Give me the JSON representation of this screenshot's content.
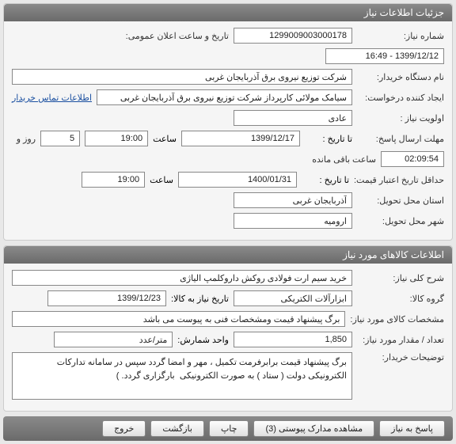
{
  "panel1": {
    "title": "جزئیات اطلاعات نیاز",
    "need_number_label": "شماره نیاز:",
    "need_number": "1299009003000178",
    "public_announce_label": "تاریخ و ساعت اعلان عمومی:",
    "public_announce": "1399/12/12 - 16:49",
    "buyer_org_label": "نام دستگاه خریدار:",
    "buyer_org": "شرکت توزیع نیروی برق آذربایجان غربی",
    "creator_label": "ایجاد کننده درخواست:",
    "creator": "سیامک مولائی کارپرداز شرکت توزیع نیروی برق آذربایجان غربی",
    "buyer_contact_link": "اطلاعات تماس خریدار",
    "priority_label": "اولویت نیاز :",
    "priority": "عادی",
    "response_deadline_label": "مهلت ارسال پاسخ:",
    "until_date_label": "تا تاریخ :",
    "response_date": "1399/12/17",
    "time_label": "ساعت",
    "response_time": "19:00",
    "days_count": "5",
    "days_and": "روز و",
    "countdown": "02:09:54",
    "countdown_suffix": "ساعت باقی مانده",
    "price_validity_label": "حداقل تاریخ اعتبار قیمت:",
    "price_validity_date": "1400/01/31",
    "price_validity_time": "19:00",
    "delivery_province_label": "استان محل تحویل:",
    "delivery_province": "آذربایجان غربی",
    "delivery_city_label": "شهر محل تحویل:",
    "delivery_city": "ارومیه"
  },
  "panel2": {
    "title": "اطلاعات کالاهای مورد نیاز",
    "general_desc_label": "شرح کلی نیاز:",
    "general_desc": "خرید سیم ارت فولادی روکش داروکلمپ الیاژی",
    "goods_group_label": "گروه کالا:",
    "goods_group": "ابزارآلات الکتریکی",
    "need_by_date_label": "تاریخ نیاز به کالا:",
    "need_by_date": "1399/12/23",
    "spec_label": "مشخصات کالای مورد نیاز:",
    "spec": "برگ پیشنهاد قیمت ومشخصات فنی به پیوست می باشد",
    "qty_label": "تعداد / مقدار مورد نیاز:",
    "qty": "1,850",
    "unit_label": "واحد شمارش:",
    "unit": "متر/عدد",
    "buyer_notes_label": "توضیحات خریدار:",
    "buyer_notes": "برگ پیشنهاد قیمت برابرفرمت تکمیل ، مهر و امضا گردد سپس در سامانه تدارکات الکترونیکی دولت ( ستاد ) به صورت الکترونیکی  بارگزاری گردد. )"
  },
  "buttons": {
    "respond": "پاسخ به نیاز",
    "attachments": "مشاهده مدارک پیوستی  (3)",
    "print": "چاپ",
    "back": "بازگشت",
    "exit": "خروج"
  }
}
